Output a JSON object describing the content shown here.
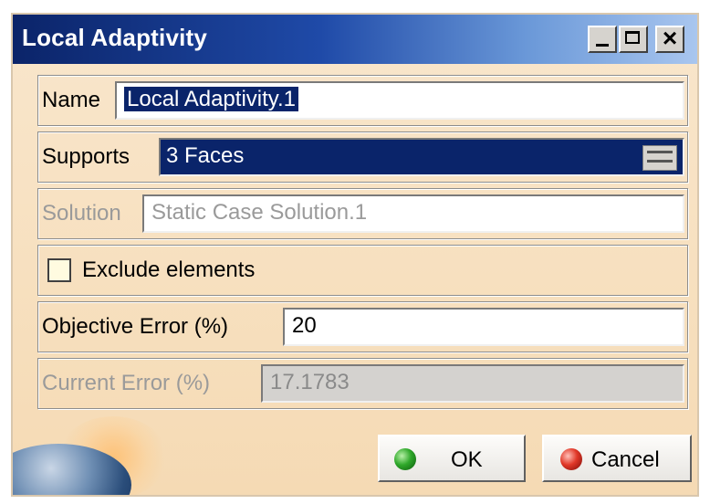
{
  "window": {
    "title": "Local Adaptivity",
    "controls": {
      "minimize": "minimize-icon",
      "maximize": "maximize-icon",
      "close": "close-icon"
    }
  },
  "name_row": {
    "label": "Name",
    "value": "Local Adaptivity.1"
  },
  "supports_row": {
    "label": "Supports",
    "value": "3 Faces"
  },
  "solution_row": {
    "label": "Solution",
    "value": "Static Case Solution.1"
  },
  "exclude_row": {
    "label": "Exclude elements",
    "checked": false
  },
  "objective_row": {
    "label": "Objective Error (%)",
    "value": "20"
  },
  "current_row": {
    "label": "Current Error (%)",
    "value": "17.1783"
  },
  "buttons": {
    "ok": "OK",
    "cancel": "Cancel"
  },
  "colors": {
    "title_gradient_start": "#0b2469",
    "title_gradient_end": "#a9c6ef",
    "selection": "#0a246a",
    "dialog_bg": "#f7e0bf"
  }
}
